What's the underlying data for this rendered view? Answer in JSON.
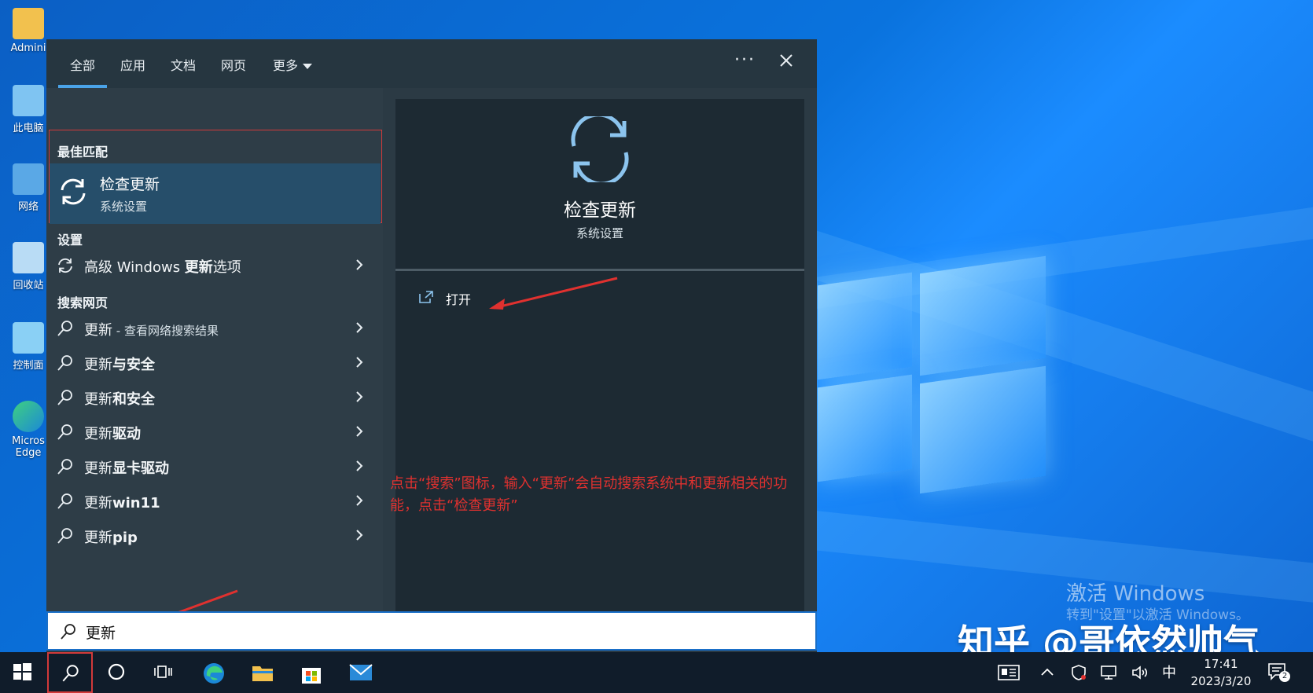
{
  "desktop": {
    "icons": [
      {
        "label": "Admini"
      },
      {
        "label": "此电脑"
      },
      {
        "label": "网络"
      },
      {
        "label": "回收站"
      },
      {
        "label": "控制面"
      },
      {
        "label": "Micros Edge"
      }
    ],
    "watermark_title": "激活 Windows",
    "watermark_sub": "转到\"设置\"以激活 Windows。",
    "credit": "知乎 @哥依然帅气"
  },
  "tabs": [
    {
      "label": "全部",
      "active": true
    },
    {
      "label": "应用"
    },
    {
      "label": "文档"
    },
    {
      "label": "网页"
    },
    {
      "label": "更多"
    }
  ],
  "sections": {
    "best_match": "最佳匹配",
    "settings": "设置",
    "web": "搜索网页"
  },
  "best_match": {
    "title": "检查更新",
    "subtitle": "系统设置"
  },
  "settings_items": [
    {
      "pre": "高级 Windows ",
      "bold": "更新",
      "post": "选项"
    }
  ],
  "web_items": [
    {
      "pre": "更新",
      "bold": "",
      "post": " - 查看网络搜索结果"
    },
    {
      "pre": "更新",
      "bold": "与安全",
      "post": ""
    },
    {
      "pre": "更新",
      "bold": "和安全",
      "post": ""
    },
    {
      "pre": "更新",
      "bold": "驱动",
      "post": ""
    },
    {
      "pre": "更新",
      "bold": "显卡驱动",
      "post": ""
    },
    {
      "pre": "更新",
      "bold": "win11",
      "post": ""
    },
    {
      "pre": "更新",
      "bold": "pip",
      "post": ""
    }
  ],
  "detail": {
    "title": "检查更新",
    "subtitle": "系统设置",
    "open_label": "打开"
  },
  "annotation": "点击“搜索”图标，输入“更新”会自动搜索系统中和更新相关的功能，点击“检查更新”",
  "search": {
    "value": "更新"
  },
  "taskbar": {
    "ime": "中",
    "time": "17:41",
    "date": "2023/3/20",
    "notif_count": "2"
  },
  "colors": {
    "accent": "#4aa3e8",
    "highlight_border": "#d23a3a",
    "annotation": "#e0312f"
  }
}
